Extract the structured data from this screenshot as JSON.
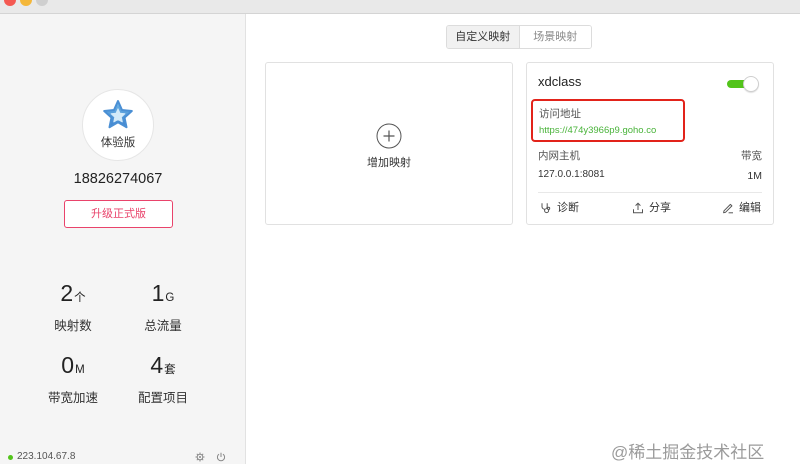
{
  "colors": {
    "window_close": "#f45952",
    "window_minimize": "#f4b73a",
    "window_zoom": "#cfcfcf",
    "switch_on": "#52c41a",
    "link": "#48b339",
    "upgrade": "#e9436b",
    "highlight": "#e2231a"
  },
  "sidebar": {
    "avatar": {
      "icon": "star-icon",
      "badge_label": "体验版"
    },
    "phone": "18826274067",
    "upgrade_label": "升级正式版",
    "stats": [
      {
        "value": "2",
        "unit": "个",
        "label": "映射数"
      },
      {
        "value": "1",
        "unit": "G",
        "label": "总流量"
      },
      {
        "value": "0",
        "unit": "M",
        "label": "带宽加速"
      },
      {
        "value": "4",
        "unit": "套",
        "label": "配置项目"
      }
    ],
    "status": {
      "ip": "223.104.67.8",
      "icons": [
        "gear-icon",
        "power-icon"
      ]
    }
  },
  "main": {
    "tabs": [
      {
        "label": "自定义映射",
        "selected": true
      },
      {
        "label": "场景映射",
        "selected": false
      }
    ],
    "add_card": {
      "icon": "plus-circle-icon",
      "label": "增加映射"
    },
    "mappings": [
      {
        "name": "xdclass",
        "enabled": true,
        "access_label": "访问地址",
        "access_url": "https://474y3966p9.goho.co",
        "host_label": "内网主机",
        "host": "127.0.0.1:8081",
        "bandwidth_label": "带宽",
        "bandwidth": "1M",
        "actions": [
          {
            "label": "诊断",
            "icon": "stethoscope-icon"
          },
          {
            "label": "分享",
            "icon": "share-icon"
          },
          {
            "label": "编辑",
            "icon": "pencil-icon"
          }
        ]
      }
    ]
  },
  "watermark": "@稀土掘金技术社区"
}
